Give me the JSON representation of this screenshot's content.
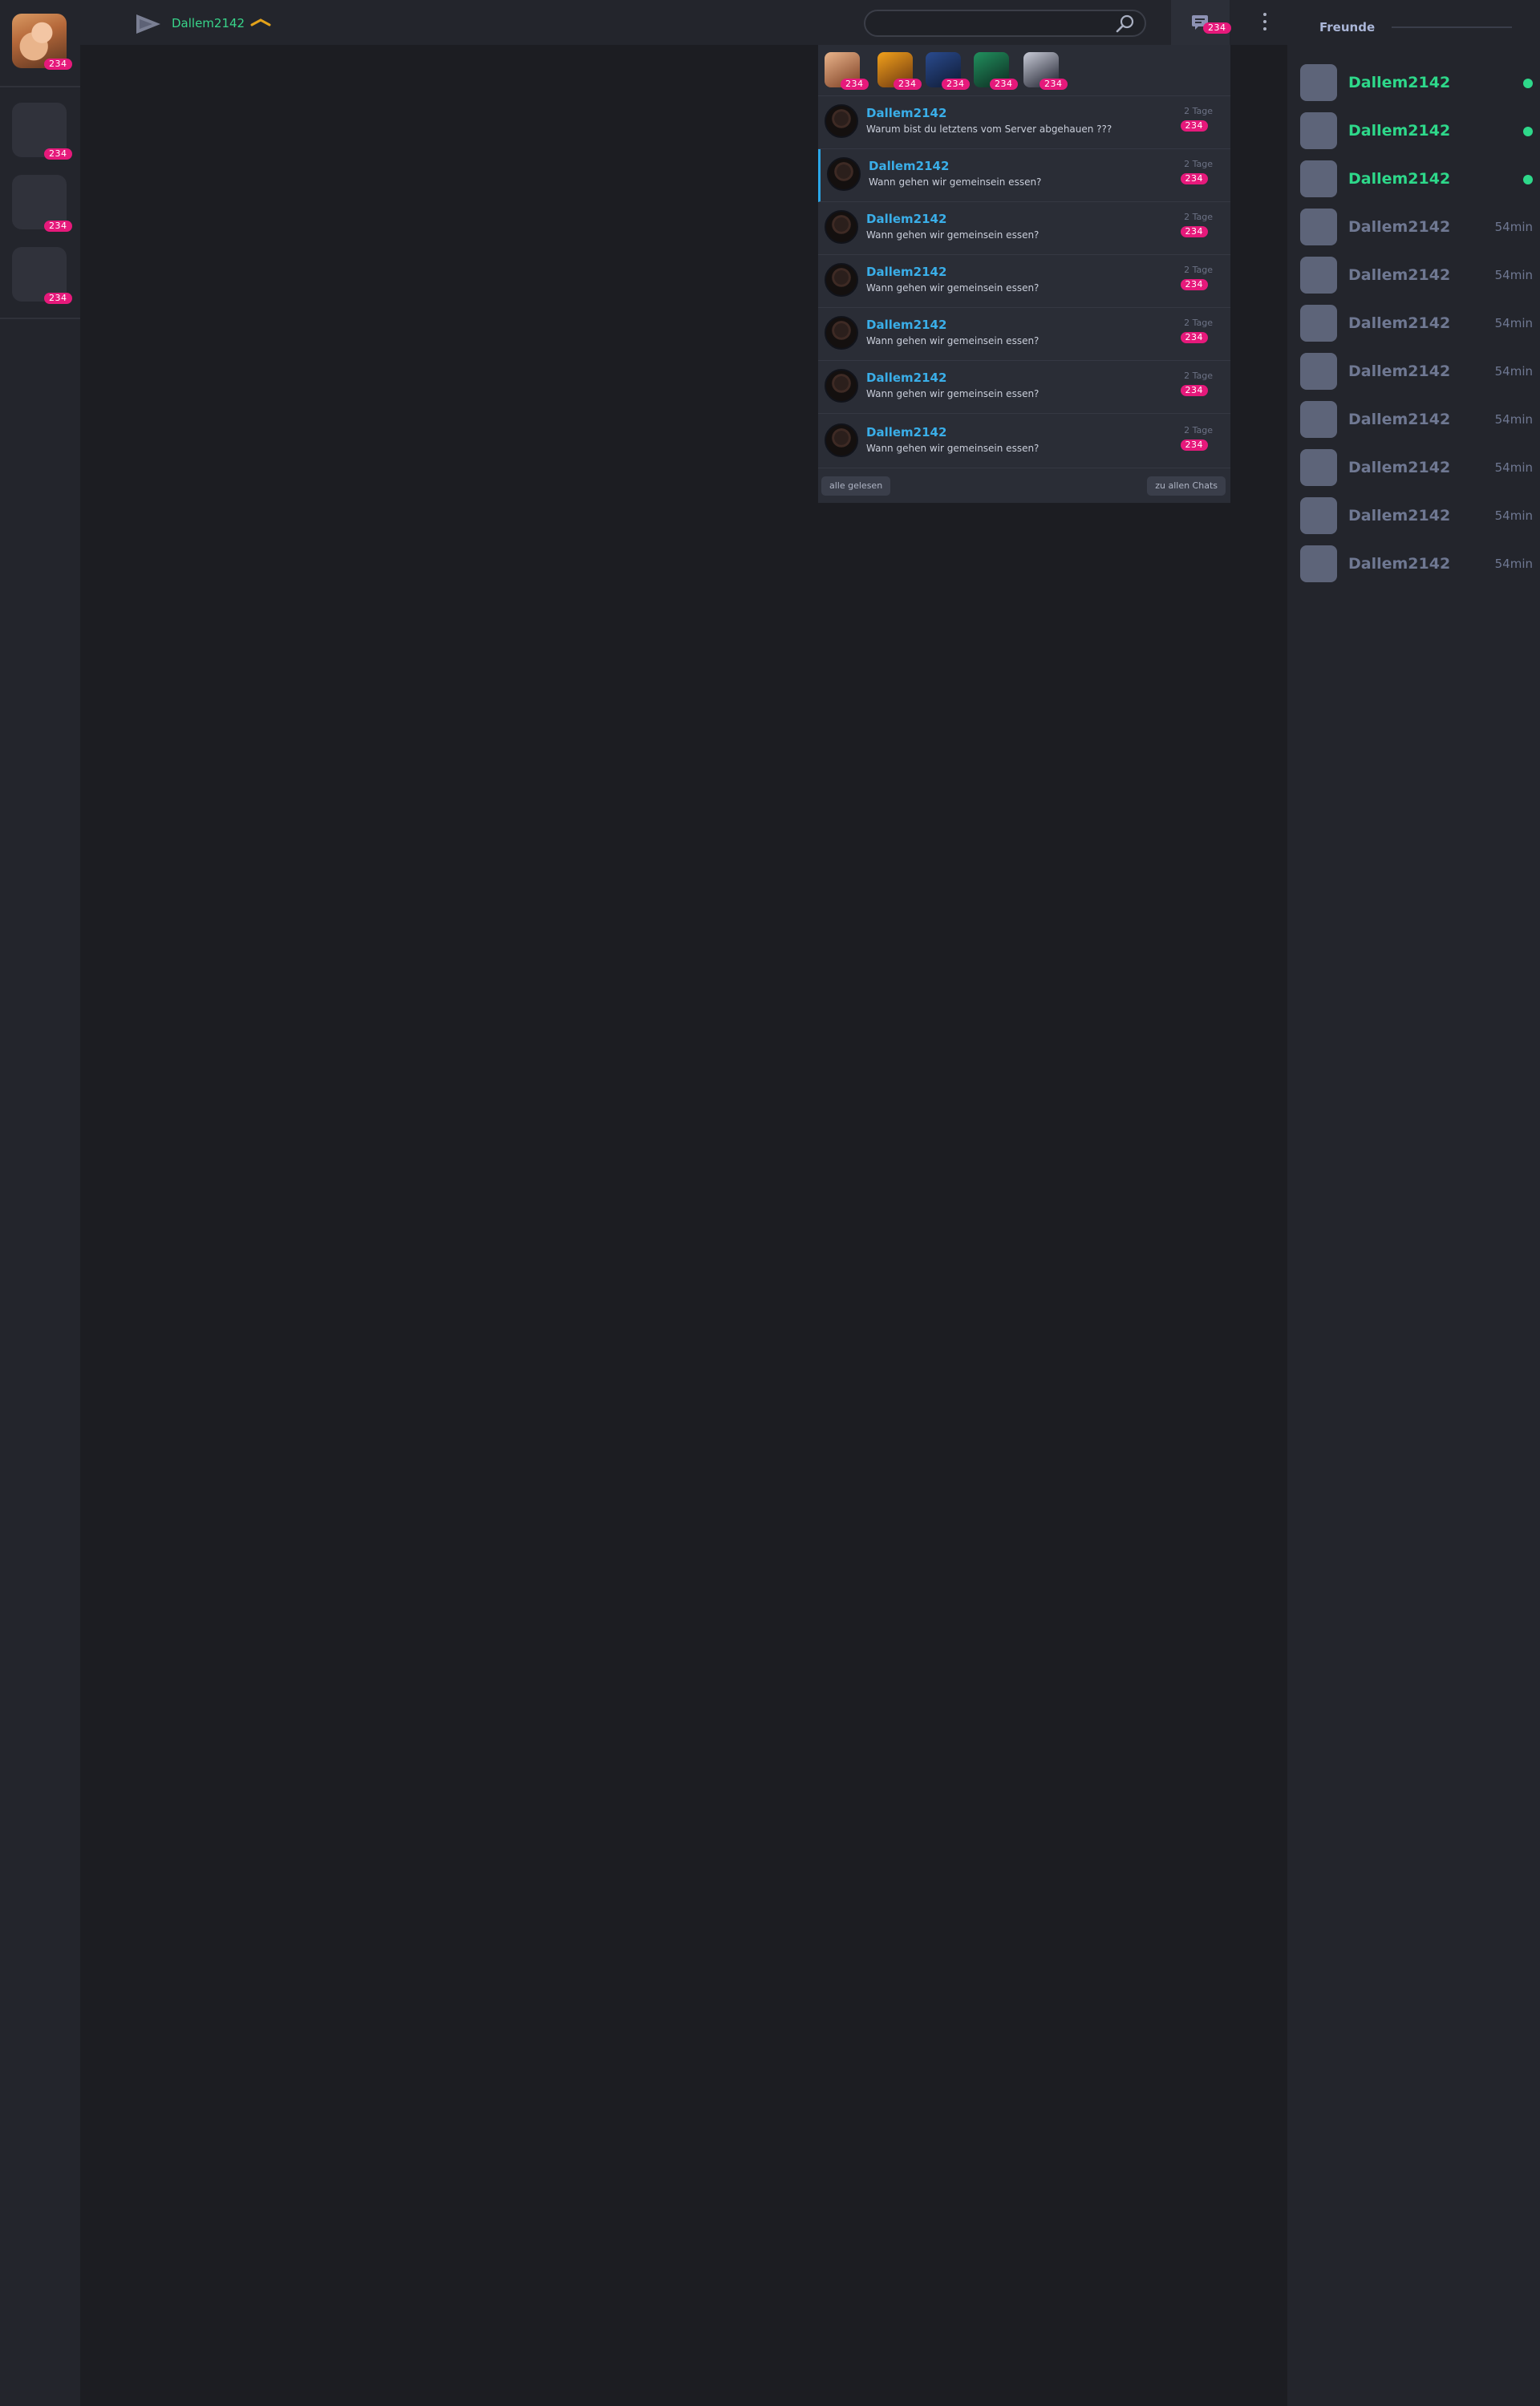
{
  "left_rail": {
    "user_badge": "234",
    "servers": [
      {
        "badge": "234"
      },
      {
        "badge": "234"
      },
      {
        "badge": "234"
      }
    ]
  },
  "topbar": {
    "username": "Dallem2142",
    "search_placeholder": "",
    "chat_badge": "234"
  },
  "dropdown": {
    "stories": [
      {
        "badge": "234",
        "color_a": "#e9b48b",
        "color_b": "#7b3d22"
      },
      {
        "badge": "234",
        "color_a": "#f2a11b",
        "color_b": "#6a3510"
      },
      {
        "badge": "234",
        "color_a": "#2a4b8e",
        "color_b": "#0f1a33"
      },
      {
        "badge": "234",
        "color_a": "#21905e",
        "color_b": "#0d2a20"
      },
      {
        "badge": "234",
        "color_a": "#c9ccd8",
        "color_b": "#1b1d2a"
      }
    ],
    "messages": [
      {
        "name": "Dallem2142",
        "text": "Warum bist du letztens vom Server abgehauen ???",
        "time": "2 Tage",
        "badge": "234",
        "active": false
      },
      {
        "name": "Dallem2142",
        "text": "Wann gehen wir gemeinsein essen?",
        "time": "2 Tage",
        "badge": "234",
        "active": true
      },
      {
        "name": "Dallem2142",
        "text": "Wann gehen wir gemeinsein essen?",
        "time": "2 Tage",
        "badge": "234",
        "active": false
      },
      {
        "name": "Dallem2142",
        "text": "Wann gehen wir gemeinsein essen?",
        "time": "2 Tage",
        "badge": "234",
        "active": false
      },
      {
        "name": "Dallem2142",
        "text": "Wann gehen wir gemeinsein essen?",
        "time": "2 Tage",
        "badge": "234",
        "active": false
      },
      {
        "name": "Dallem2142",
        "text": "Wann gehen wir gemeinsein essen?",
        "time": "2 Tage",
        "badge": "234",
        "active": false
      },
      {
        "name": "Dallem2142",
        "text": "Wann gehen wir gemeinsein essen?",
        "time": "2 Tage",
        "badge": "234",
        "active": false
      }
    ],
    "mark_all_read": "alle gelesen",
    "all_chats": "zu allen Chats"
  },
  "friends": {
    "title": "Freunde",
    "list": [
      {
        "name": "Dallem2142",
        "online": true,
        "last_seen": ""
      },
      {
        "name": "Dallem2142",
        "online": true,
        "last_seen": ""
      },
      {
        "name": "Dallem2142",
        "online": true,
        "last_seen": ""
      },
      {
        "name": "Dallem2142",
        "online": false,
        "last_seen": "54min"
      },
      {
        "name": "Dallem2142",
        "online": false,
        "last_seen": "54min"
      },
      {
        "name": "Dallem2142",
        "online": false,
        "last_seen": "54min"
      },
      {
        "name": "Dallem2142",
        "online": false,
        "last_seen": "54min"
      },
      {
        "name": "Dallem2142",
        "online": false,
        "last_seen": "54min"
      },
      {
        "name": "Dallem2142",
        "online": false,
        "last_seen": "54min"
      },
      {
        "name": "Dallem2142",
        "online": false,
        "last_seen": "54min"
      },
      {
        "name": "Dallem2142",
        "online": false,
        "last_seen": "54min"
      }
    ]
  },
  "colors": {
    "accent_green": "#2ed88a",
    "accent_blue": "#3aaee8",
    "badge_pink": "#e6197b"
  }
}
